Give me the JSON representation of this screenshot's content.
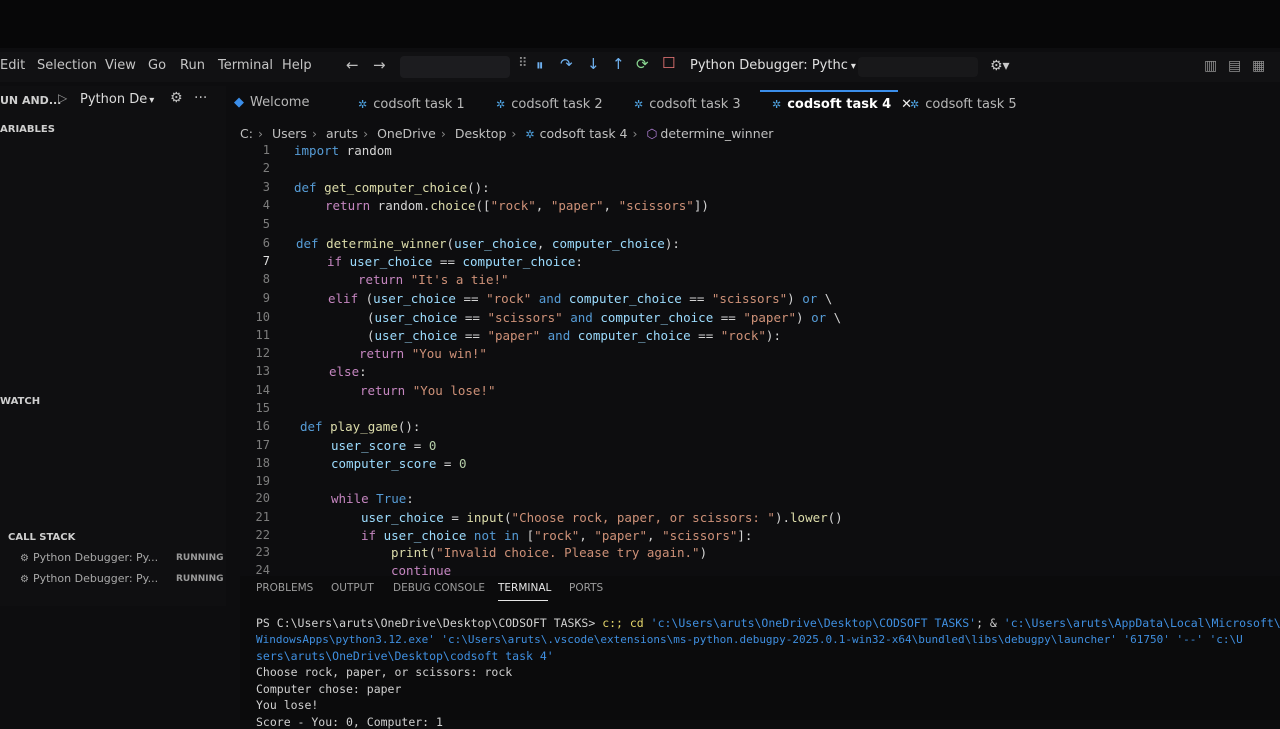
{
  "menu": {
    "edit": "Edit",
    "selection": "Selection",
    "view": "View",
    "go": "Go",
    "run": "Run",
    "terminal": "Terminal",
    "help": "Help"
  },
  "debug": {
    "config": "Python Debugger: Pythc",
    "pause": "⏸",
    "step_over": "↷",
    "step_into": "↓",
    "step_out": "↑",
    "restart": "⟳",
    "stop": "☐"
  },
  "sidebar": {
    "run_title": "UN AND...",
    "run_config": "Python De",
    "variables": "ARIABLES",
    "watch": "WATCH",
    "call_stack": "CALL STACK",
    "threads": [
      {
        "label": "Python Debugger: Py...",
        "state": "RUNNING"
      },
      {
        "label": "Python Debugger: Py...",
        "state": "RUNNING"
      }
    ]
  },
  "tabs": [
    {
      "label": "Welcome"
    },
    {
      "label": "codsoft task 1"
    },
    {
      "label": "codsoft task 2"
    },
    {
      "label": "codsoft task 3"
    },
    {
      "label": "codsoft task 4"
    },
    {
      "label": "codsoft task 5"
    }
  ],
  "breadcrumb": [
    "C:",
    "Users",
    "aruts",
    "OneDrive",
    "Desktop",
    "codsoft task 4",
    "determine_winner"
  ],
  "panel": {
    "tabs": [
      "PROBLEMS",
      "OUTPUT",
      "DEBUG CONSOLE",
      "TERMINAL",
      "PORTS"
    ],
    "terminal": {
      "prompt": "PS C:\\Users\\aruts\\OneDrive\\Desktop\\CODSOFT TASKS>",
      "cmd_a": " c:; cd ",
      "cmd_b": "'c:\\Users\\aruts\\OneDrive\\Desktop\\CODSOFT TASKS'",
      "cmd_c": "; & ",
      "cmd_d": "'c:\\Users\\aruts\\AppData\\Local\\Microsoft\\",
      "line2": "WindowsApps\\python3.12.exe' 'c:\\Users\\aruts\\.vscode\\extensions\\ms-python.debugpy-2025.0.1-win32-x64\\bundled\\libs\\debugpy\\launcher' '61750' '--' 'c:\\U",
      "line3": "sers\\aruts\\OneDrive\\Desktop\\codsoft task 4'",
      "out1": "Choose rock, paper, or scissors: rock",
      "out2": "Computer chose: paper",
      "out3": "You lose!",
      "out4": "Score - You: 0, Computer: 1"
    }
  },
  "code": {
    "l1": {
      "n": "1",
      "t": [
        [
          "kw",
          "import"
        ],
        [
          "",
          "  random"
        ]
      ]
    }
  }
}
